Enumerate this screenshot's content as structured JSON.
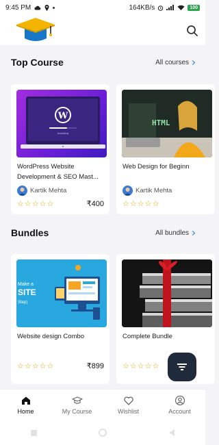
{
  "status_bar": {
    "time": "9:45 PM",
    "speed": "164KB/s",
    "battery": "100"
  },
  "header": {
    "logo_icon": "graduation-cap-logo",
    "search_icon": "search-icon"
  },
  "top_course": {
    "title": "Top Course",
    "link_label": "All courses",
    "cards": [
      {
        "title": "WordPress Website Development & SEO Mast...",
        "author": "Kartik Mehta",
        "stars": "☆☆☆☆☆",
        "price": "₹400"
      },
      {
        "title": "Web Design for Beginn",
        "author": "Kartik Mehta",
        "stars": "☆☆☆☆☆",
        "price": ""
      }
    ]
  },
  "bundles": {
    "title": "Bundles",
    "link_label": "All bundles",
    "cards": [
      {
        "title": "Website design Combo",
        "stars": "☆☆☆☆☆",
        "price": "₹899",
        "thumb_text_1": "Make a",
        "thumb_text_2": "SITE",
        "thumb_text_3": "Step)"
      },
      {
        "title": "Complete Bundle",
        "stars": "☆☆☆☆☆",
        "price": ""
      }
    ]
  },
  "wordpress_thumb_text": "Installing",
  "html_thumb_text": "HTML",
  "filter_icon": "filter-icon",
  "bottom_nav": [
    {
      "label": "Home",
      "icon": "home-icon",
      "active": true
    },
    {
      "label": "My Course",
      "icon": "graduation-cap-icon",
      "active": false
    },
    {
      "label": "Wishlist",
      "icon": "heart-icon",
      "active": false
    },
    {
      "label": "Account",
      "icon": "account-icon",
      "active": false
    }
  ],
  "colors": {
    "accent": "#1a78d6",
    "fab": "#1f2b3a",
    "star": "#e0a800"
  }
}
